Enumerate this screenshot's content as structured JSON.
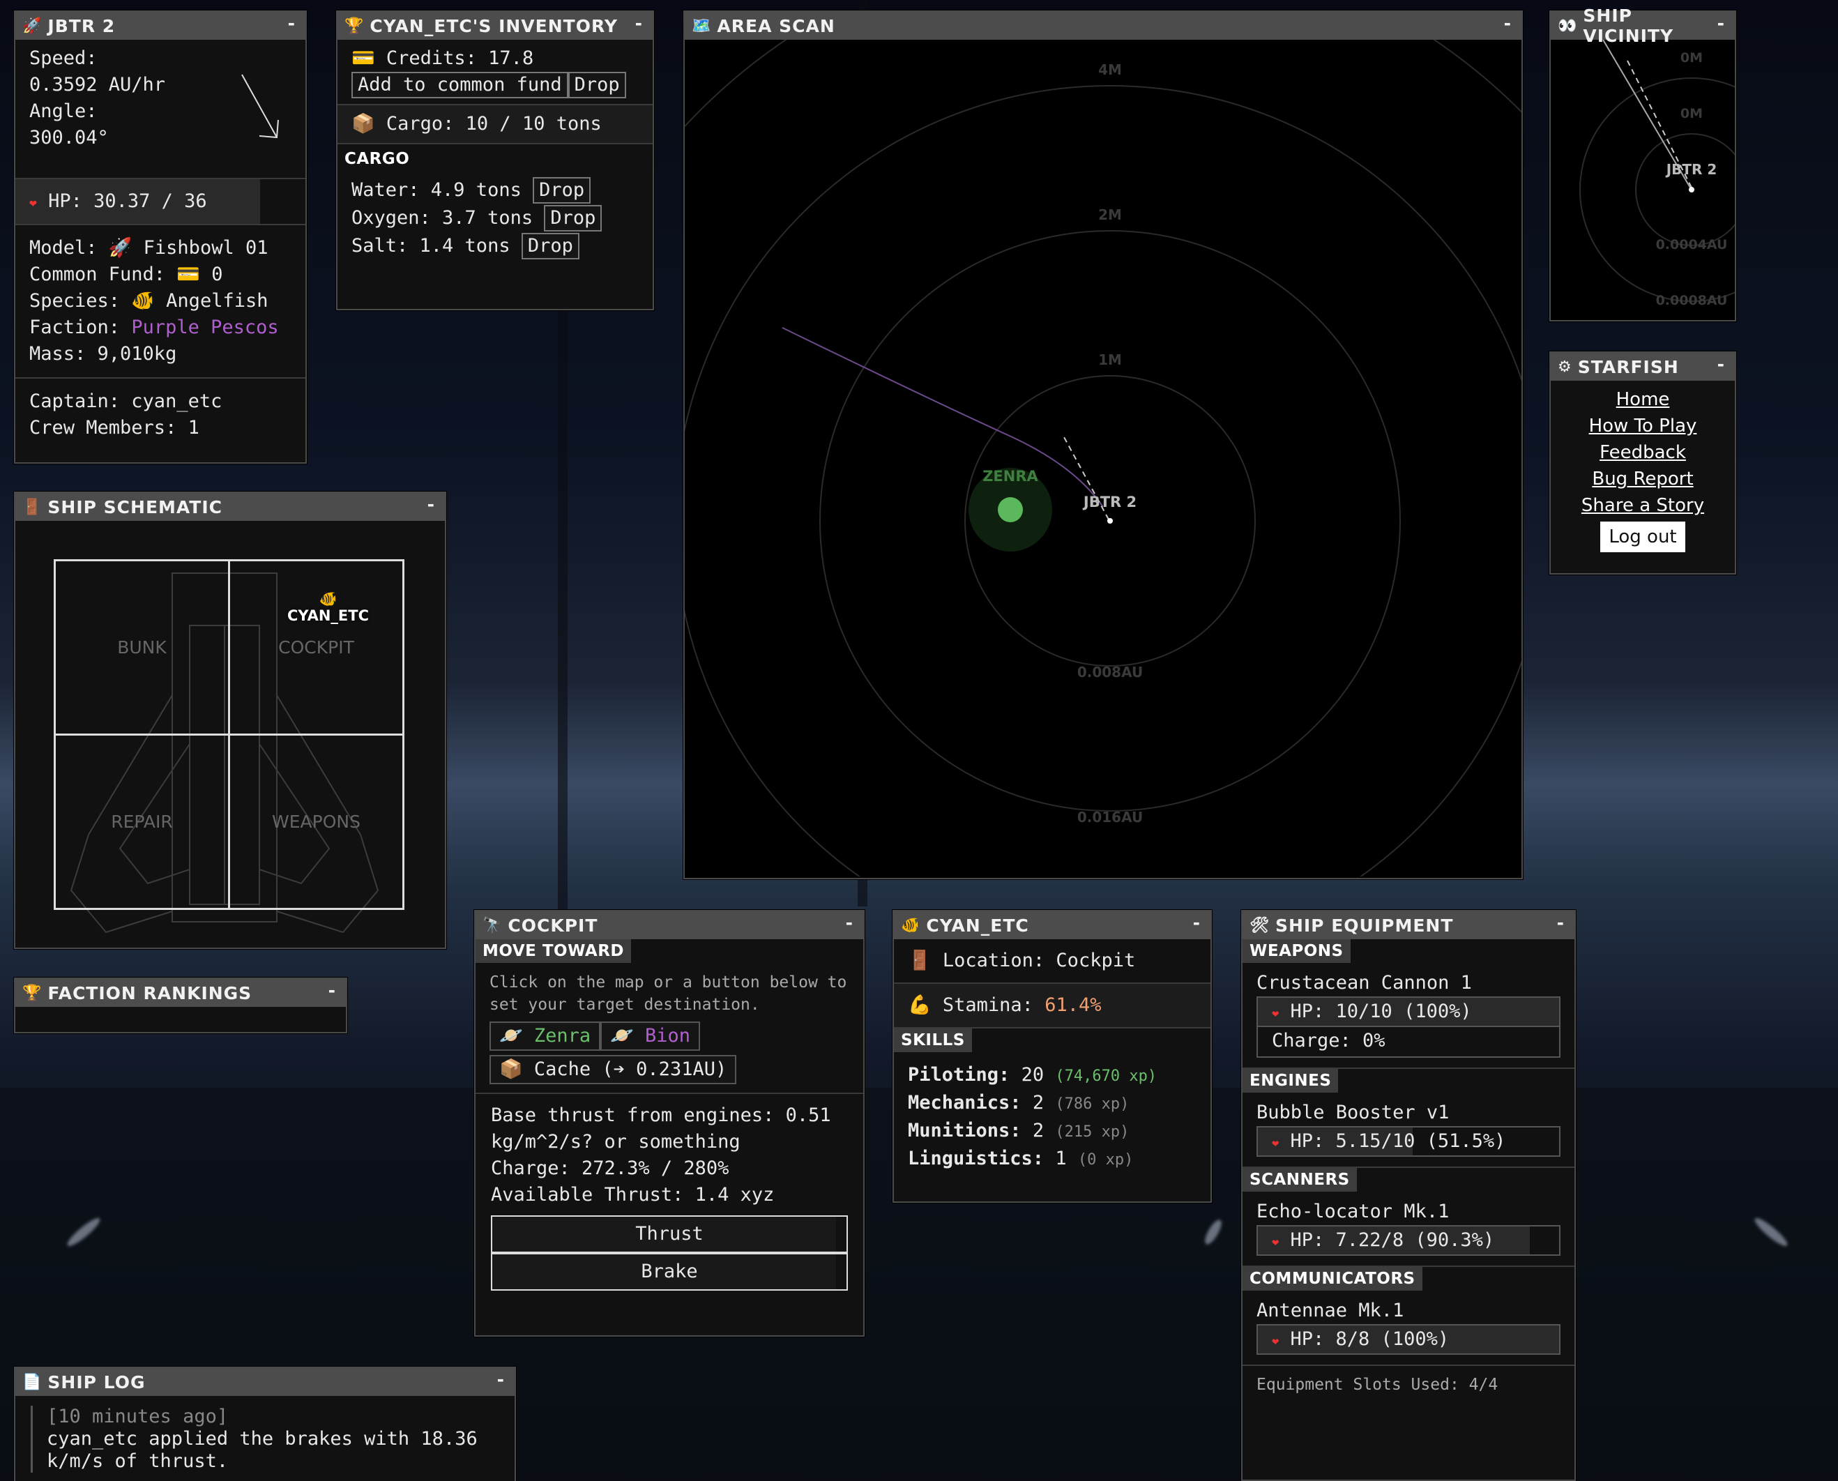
{
  "background": {
    "deck_color": "#0a0c10"
  },
  "ship_panel": {
    "icon": "rocket-icon",
    "title": "JBTR 2",
    "minimize": "-",
    "speed_label": "Speed:",
    "speed_value": "0.3592 AU/hr",
    "angle_label": "Angle:",
    "angle_value": "300.04°",
    "hp_text": "HP: 30.37 / 36",
    "hp_fraction": 0.8436,
    "model": "Model: 🚀 Fishbowl 01",
    "common_fund": "Common Fund: 💳 0",
    "species": "Species: 🐠 Angelfish",
    "faction_label": "Faction:",
    "faction_value": "Purple Pescos",
    "mass": "Mass: 9,010kg",
    "captain": "Captain: cyan_etc",
    "crew": "Crew Members: 1"
  },
  "inventory": {
    "icon": "trophy-icon",
    "title": "CYAN_ETC'S INVENTORY",
    "minimize": "-",
    "credits": "💳 Credits: 17.8",
    "add_fund": "Add to common fund",
    "drop": "Drop",
    "cargo_summary": "📦 Cargo: 10 / 10 tons",
    "cargo_label": "CARGO",
    "items": [
      {
        "name": "Water: 4.9 tons",
        "drop": "Drop"
      },
      {
        "name": "Oxygen: 3.7 tons",
        "drop": "Drop"
      },
      {
        "name": "Salt: 1.4 tons",
        "drop": "Drop"
      }
    ]
  },
  "area_scan": {
    "icon": "map-icon",
    "title": "AREA SCAN",
    "minimize": "-",
    "ring_labels": [
      "4M",
      "2M",
      "1M",
      "0.008AU",
      "0.016AU"
    ],
    "planet": "ZENRA",
    "ship": "JBTR 2",
    "planet_color": "#5cb85c"
  },
  "vicinity": {
    "icon": "eyes-icon",
    "title": "SHIP VICINITY",
    "minimize": "-",
    "labels": [
      "0M",
      "0M",
      "0.0004AU",
      "0.0008AU"
    ],
    "ship": "JBTR 2"
  },
  "starfish": {
    "icon": "gear-icon",
    "title": "STARFISH",
    "minimize": "-",
    "links": [
      "Home",
      "How To Play",
      "Feedback",
      "Bug Report",
      "Share a Story"
    ],
    "logout": "Log out"
  },
  "schematic": {
    "icon": "door-icon",
    "title": "SHIP SCHEMATIC",
    "minimize": "-",
    "rooms": [
      "BUNK",
      "COCKPIT",
      "REPAIR",
      "WEAPONS"
    ],
    "crew_label": "CYAN_ETC",
    "crew_icon": "🐠"
  },
  "faction": {
    "icon": "trophy-icon",
    "title": "FACTION RANKINGS",
    "minimize": "-"
  },
  "cockpit": {
    "icon": "telescope-icon",
    "title": "COCKPIT",
    "minimize": "-",
    "move_label": "MOVE TOWARD",
    "instructions": "Click on the map or a button below to set your target destination.",
    "targets": [
      "🪐 Zenra",
      "🪐 Bion"
    ],
    "cache": "📦 Cache (➔ 0.231AU)",
    "base_thrust": "Base thrust from engines: 0.51 kg/m^2/s? or something",
    "charge": "Charge: 272.3% / 280%",
    "available": "Available Thrust: 1.4 xyz",
    "thrust_btn": "Thrust",
    "brake_btn": "Brake"
  },
  "crew": {
    "icon": "fish-icon",
    "title": "CYAN_ETC",
    "minimize": "-",
    "location": "🚪 Location: Cockpit",
    "stamina_label": "💪 Stamina:",
    "stamina_value": "61.4%",
    "skills_label": "SKILLS",
    "skills": [
      {
        "name": "Piloting:",
        "level": "20",
        "xp": "(74,670 xp)"
      },
      {
        "name": "Mechanics:",
        "level": "2",
        "xp": "(786 xp)"
      },
      {
        "name": "Munitions:",
        "level": "2",
        "xp": "(215 xp)"
      },
      {
        "name": "Linguistics:",
        "level": "1",
        "xp": "(0 xp)"
      }
    ]
  },
  "equipment": {
    "icon": "tools-icon",
    "title": "SHIP EQUIPMENT",
    "minimize": "-",
    "sections": [
      {
        "label": "WEAPONS",
        "name": "Crustacean Cannon 1",
        "hp": "HP: 10/10 (100%)",
        "hp_fraction": 1.0,
        "charge": "Charge: 0%"
      },
      {
        "label": "ENGINES",
        "name": "Bubble Booster v1",
        "hp": "HP: 5.15/10 (51.5%)",
        "hp_fraction": 0.515
      },
      {
        "label": "SCANNERS",
        "name": "Echo-locator Mk.1",
        "hp": "HP: 7.22/8 (90.3%)",
        "hp_fraction": 0.903
      },
      {
        "label": "COMMUNICATORS",
        "name": "Antennae Mk.1",
        "hp": "HP: 8/8 (100%)",
        "hp_fraction": 1.0
      }
    ],
    "slots": "Equipment Slots Used: 4/4"
  },
  "log": {
    "icon": "page-icon",
    "title": "SHIP LOG",
    "minimize": "-",
    "time": "[10 minutes ago]",
    "message": "cyan_etc applied the brakes with 18.36 k/m/s of thrust."
  }
}
